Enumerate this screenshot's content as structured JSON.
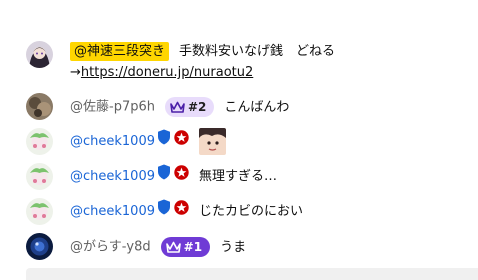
{
  "messages": [
    {
      "author": "@神速三段突き",
      "text_before_link": "手数料安いなげ銭　どねる→",
      "link": "https://doneru.jp/nuraotu2"
    },
    {
      "author": "@佐藤-p7p6h",
      "rank": "#2",
      "text": "こんばんわ"
    },
    {
      "author": "@cheek1009",
      "badges": [
        "shield-icon",
        "star-icon"
      ],
      "sticker": true
    },
    {
      "author": "@cheek1009",
      "badges": [
        "shield-icon",
        "star-icon"
      ],
      "text": "無理すぎる…"
    },
    {
      "author": "@cheek1009",
      "badges": [
        "shield-icon",
        "star-icon"
      ],
      "text": "じたカビのにおい"
    },
    {
      "author": "@がらす-y8d",
      "rank": "#1",
      "text": "うま"
    }
  ],
  "colors": {
    "owner_highlight": "#ffd600",
    "moderator_name": "#1a65d6",
    "rank_light": "#e8dcfb",
    "rank_dark": "#6f3bd5",
    "star_badge": "#cc0000"
  }
}
